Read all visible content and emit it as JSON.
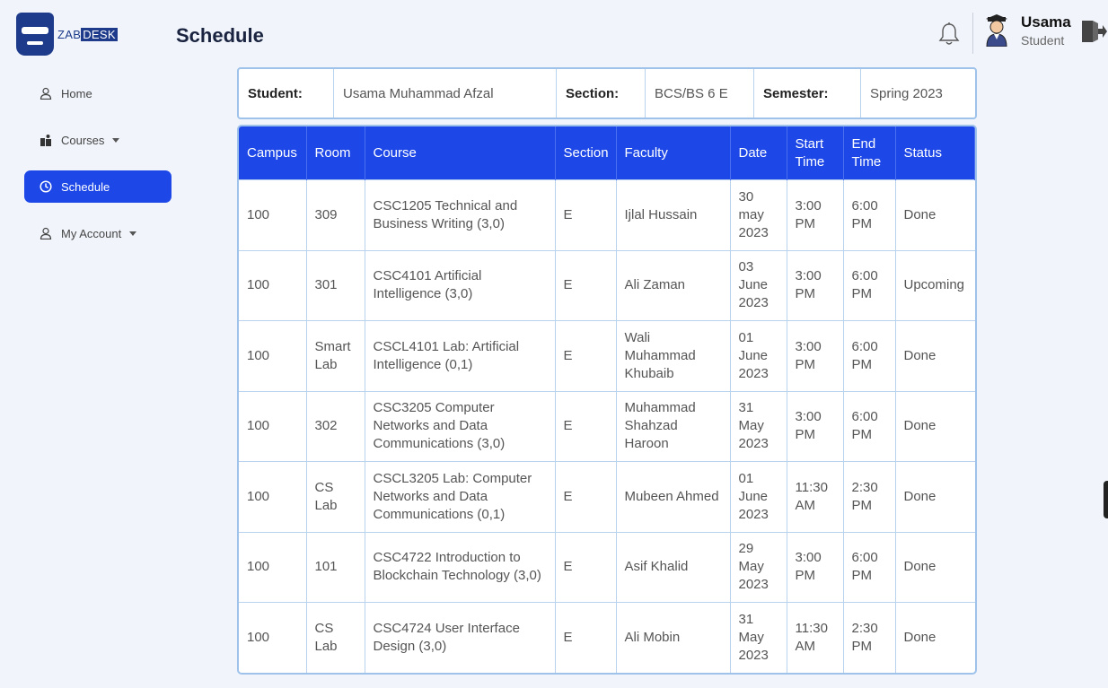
{
  "app": {
    "logo_prefix": "ZAB",
    "logo_suffix": "DESK",
    "page_title": "Schedule"
  },
  "user": {
    "name": "Usama",
    "role": "Student"
  },
  "sidebar": {
    "items": [
      {
        "label": "Home",
        "icon": "user-icon"
      },
      {
        "label": "Courses",
        "icon": "books-icon"
      },
      {
        "label": "Schedule",
        "icon": "clock-icon"
      },
      {
        "label": "My Account",
        "icon": "user-icon"
      }
    ]
  },
  "info": {
    "student_label": "Student:",
    "student_value": "Usama Muhammad Afzal",
    "section_label": "Section:",
    "section_value": "BCS/BS 6 E",
    "semester_label": "Semester:",
    "semester_value": "Spring 2023"
  },
  "table": {
    "headers": [
      "Campus",
      "Room",
      "Course",
      "Section",
      "Faculty",
      "Date",
      "Start Time",
      "End Time",
      "Status"
    ],
    "rows": [
      [
        "100",
        "309",
        "CSC1205 Technical and Business Writing (3,0)",
        "E",
        "Ijlal Hussain",
        "30 may 2023",
        "3:00 PM",
        "6:00 PM",
        "Done"
      ],
      [
        "100",
        "301",
        "CSC4101 Artificial Intelligence (3,0)",
        "E",
        "Ali Zaman",
        "03 June 2023",
        "3:00 PM",
        "6:00 PM",
        "Upcoming"
      ],
      [
        "100",
        "Smart Lab",
        "CSCL4101 Lab: Artificial Intelligence (0,1)",
        "E",
        "Wali Muhammad Khubaib",
        "01 June 2023",
        "3:00 PM",
        "6:00 PM",
        "Done"
      ],
      [
        "100",
        "302",
        "CSC3205 Computer Networks and Data Communications (3,0)",
        "E",
        "Muhammad Shahzad Haroon",
        "31 May 2023",
        "3:00 PM",
        "6:00 PM",
        "Done"
      ],
      [
        "100",
        "CS Lab",
        "CSCL3205 Lab: Computer Networks and Data Communications (0,1)",
        "E",
        "Mubeen Ahmed",
        "01 June 2023",
        "11:30 AM",
        "2:30 PM",
        "Done"
      ],
      [
        "100",
        "101",
        "CSC4722 Introduction to Blockchain Technology (3,0)",
        "E",
        "Asif Khalid",
        "29 May 2023",
        "3:00 PM",
        "6:00 PM",
        "Done"
      ],
      [
        "100",
        "CS Lab",
        "CSC4724 User Interface Design (3,0)",
        "E",
        "Ali Mobin",
        "31 May 2023",
        "11:30 AM",
        "2:30 PM",
        "Done"
      ]
    ]
  },
  "colors": {
    "accent": "#1d47e6",
    "border": "#9ec2ea",
    "background": "#f1f5fb"
  }
}
